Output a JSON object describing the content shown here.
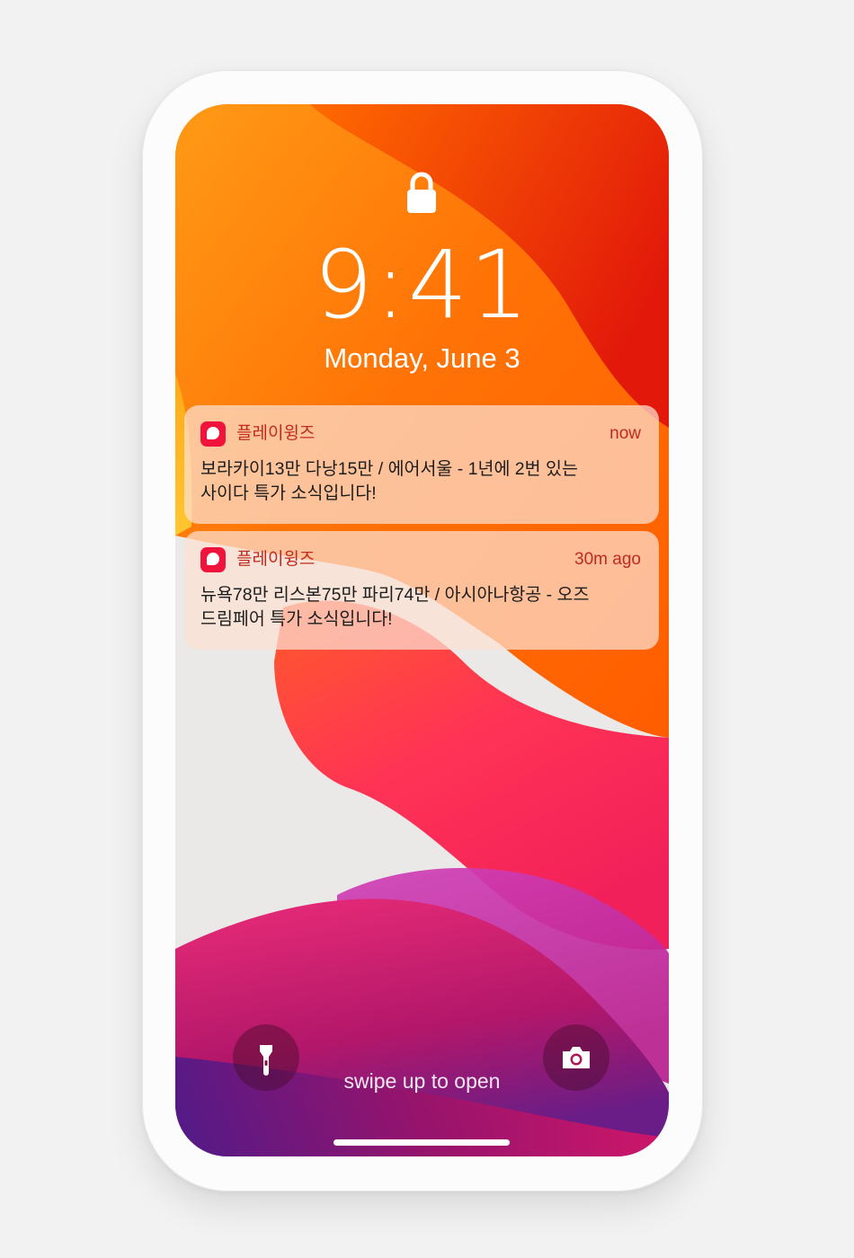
{
  "lockscreen": {
    "time": "9:41",
    "date": "Monday, June 3",
    "swipe_hint": "swipe up to open"
  },
  "notifications": [
    {
      "app_name": "플레이윙즈",
      "time": "now",
      "body": "보라카이13만 다낭15만 / 에어서울 - 1년에 2번 있는\n사이다 특가 소식입니다!"
    },
    {
      "app_name": "플레이윙즈",
      "time": "30m ago",
      "body": "뉴욕78만 리스본75만 파리74만 / 아시아나항공 - 오즈\n드림페어 특가 소식입니다!"
    }
  ],
  "colors": {
    "app_accent": "#f0143c",
    "notification_text_accent": "#c02b1e",
    "wallpaper_orange": "#ff6a00",
    "wallpaper_red": "#e01030",
    "wallpaper_purple": "#9a1c7c"
  },
  "icons": {
    "lock": "lock-icon",
    "flashlight": "flashlight-icon",
    "camera": "camera-icon"
  }
}
